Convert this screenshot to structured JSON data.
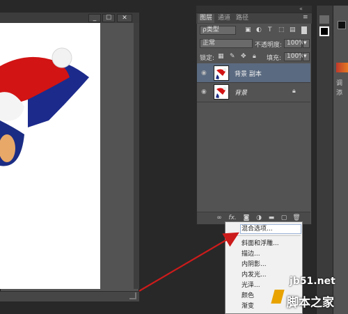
{
  "document": {
    "window_buttons": {
      "minimize": "_",
      "restore": "☐",
      "close": "✕"
    }
  },
  "panel": {
    "tabs": [
      "图层",
      "通道",
      "路径"
    ],
    "filter": {
      "kind_label": "ρ类型"
    },
    "blend_mode": "正常",
    "opacity": {
      "label": "不透明度:",
      "value": "100%"
    },
    "lock": {
      "label": "锁定:"
    },
    "fill": {
      "label": "填充:",
      "value": "100%"
    },
    "layers": [
      {
        "name": "背景 副本",
        "selected": true,
        "locked": false
      },
      {
        "name": "背景",
        "selected": false,
        "locked": true
      }
    ],
    "bottom_icons": [
      "link-icon",
      "fx-icon",
      "mask-icon",
      "adjustment-icon",
      "group-icon",
      "new-layer-icon",
      "trash-icon"
    ],
    "fx_label": "fx."
  },
  "context_menu": {
    "items": [
      "混合选项...",
      "斜面和浮雕...",
      "描边...",
      "内阴影...",
      "内发光...",
      "光泽...",
      "颜色",
      "渐变"
    ],
    "highlighted_index": 0
  },
  "right_panel": {
    "labels": [
      "调",
      "添"
    ]
  },
  "watermark": {
    "site": "jb51.net",
    "name": "脚本之家"
  },
  "colors": {
    "arrow": "#cc1b1b",
    "selected_layer": "#5a6a80",
    "panel_bg": "#535353"
  }
}
